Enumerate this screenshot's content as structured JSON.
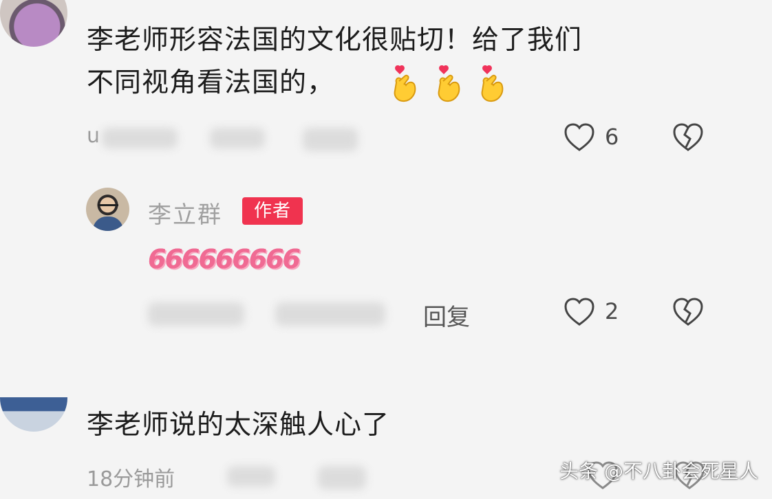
{
  "comments": [
    {
      "text_line1": "李老师形容法国的文化很贴切！给了我们",
      "text_line2": "不同视角看法国的，",
      "emoji_icon": "finger-heart-icon",
      "emoji_count": 3,
      "time_partial": "u",
      "likes": "6"
    },
    {
      "text_line1": "李老师说的太深触人心了",
      "time": "18分钟前"
    }
  ],
  "reply": {
    "author_name": "李立群",
    "author_badge": "作者",
    "content": "666666666",
    "reply_label": "回复",
    "likes": "2"
  },
  "icons": {
    "like": "heart-outline-icon",
    "dislike": "broken-heart-icon"
  },
  "colors": {
    "badge": "#f0334f",
    "emoji_666": "#f06a93",
    "meta_text": "#9a9a9a",
    "background": "#f4f4f4"
  },
  "watermark": "头条 @不八卦会死星人"
}
